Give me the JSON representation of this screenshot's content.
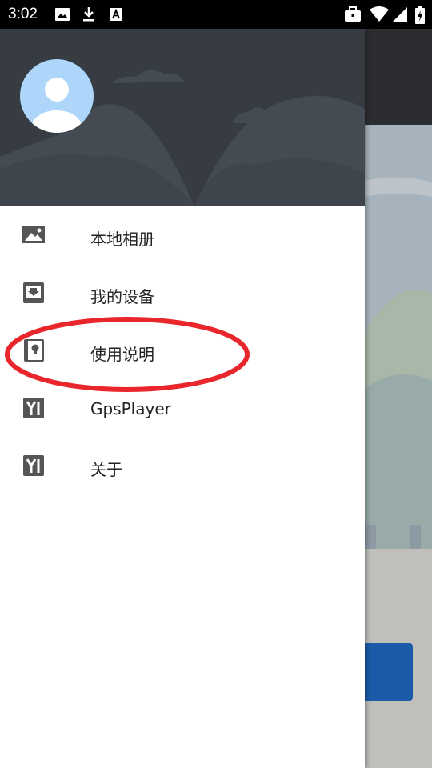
{
  "status_bar": {
    "time": "3:02",
    "left_icons": [
      "image-icon",
      "download-icon",
      "font-a-icon"
    ],
    "right_icons": [
      "briefcase-icon",
      "wifi-icon",
      "signal-icon",
      "battery-charging-icon"
    ]
  },
  "drawer": {
    "header": {
      "avatar": "avatar-icon"
    },
    "items": [
      {
        "label": "本地相册",
        "icon": "image-icon"
      },
      {
        "label": "我的设备",
        "icon": "download-box-icon"
      },
      {
        "label": "使用说明",
        "icon": "lightbulb-book-icon",
        "highlighted": true
      },
      {
        "label": "GpsPlayer",
        "icon": "yi-logo-icon"
      },
      {
        "label": "关于",
        "icon": "yi-logo-icon"
      }
    ]
  },
  "colors": {
    "header_bg": "#363c42",
    "avatar_bg": "#aed6fb",
    "annotation": "#e8262c",
    "icon": "#555555"
  }
}
